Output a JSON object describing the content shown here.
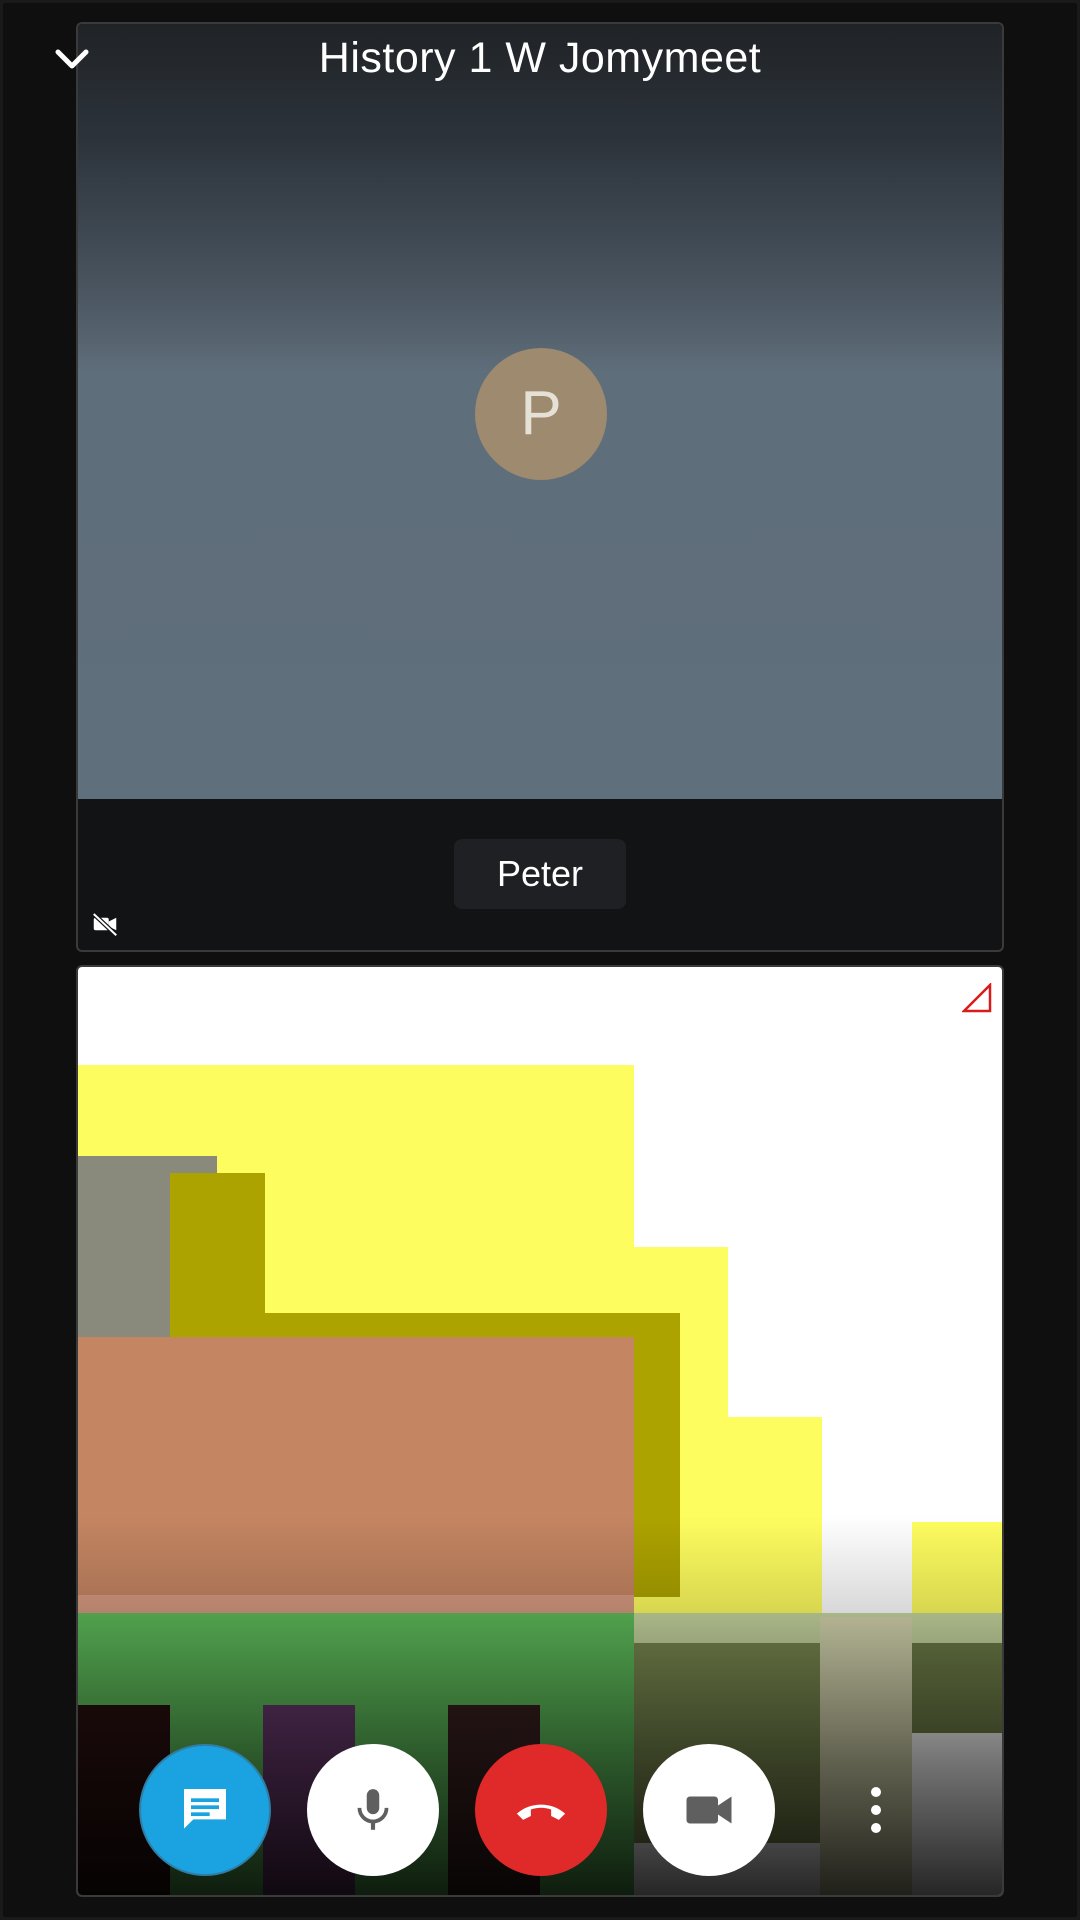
{
  "header": {
    "title": "History 1 W Jomymeet"
  },
  "remote": {
    "avatar_initial": "P",
    "name": "Peter",
    "video_muted": true
  },
  "controls": {
    "chat_icon": "chat-icon",
    "mic_icon": "mic-icon",
    "hangup_icon": "hangup-icon",
    "camera_icon": "camera-icon",
    "more_icon": "more-vertical-icon"
  },
  "colors": {
    "chat_button": "#1aa3e0",
    "hangup_button": "#e02a2a",
    "avatar": "#9e8a6e"
  }
}
